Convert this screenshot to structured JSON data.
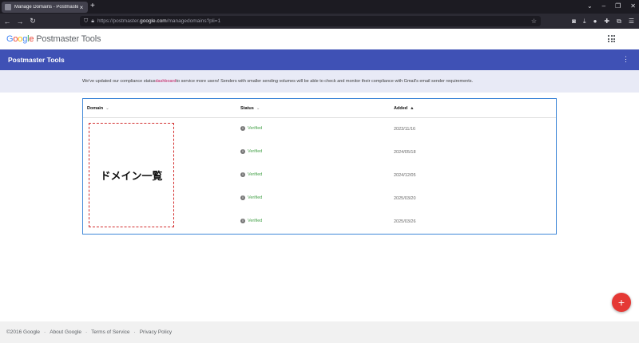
{
  "browser": {
    "tab_title": "Manage Domains - Postmaster",
    "tab_close": "×",
    "new_tab": "+",
    "url_prefix": "https://postmaster.",
    "url_domain": "google.com",
    "url_suffix": "/managedomains?pli=1"
  },
  "header": {
    "logo_g": "G",
    "logo_o1": "o",
    "logo_o2": "o",
    "logo_g2": "g",
    "logo_l": "l",
    "logo_e": "e",
    "product": "Postmaster Tools"
  },
  "appbar": {
    "title": "Postmaster Tools"
  },
  "notice": {
    "before": "We've updated our compliance status ",
    "link": "dashboard",
    "after": " to service more users! Senders with smaller sending volumes will be able to check and monitor their compliance with Gmail's email sender requirements."
  },
  "table": {
    "headers": {
      "domain": "Domain",
      "status": "Status",
      "added": "Added"
    },
    "redaction_label": "ドメイン一覧",
    "rows": [
      {
        "status": "Verified",
        "added": "2023/11/16"
      },
      {
        "status": "Verified",
        "added": "2024/05/18"
      },
      {
        "status": "Verified",
        "added": "2024/12/05"
      },
      {
        "status": "Verified",
        "added": "2025/03/20"
      },
      {
        "status": "Verified",
        "added": "2025/03/26"
      }
    ]
  },
  "fab": {
    "label": "+"
  },
  "footer": {
    "copyright": "©2016 Google",
    "about": "About Google",
    "terms": "Terms of Service",
    "privacy": "Privacy Policy",
    "separator": "·"
  },
  "colors": {
    "accent": "#3f51b5",
    "verified": "#43a047",
    "fab": "#e53935",
    "link": "#c2185b"
  }
}
